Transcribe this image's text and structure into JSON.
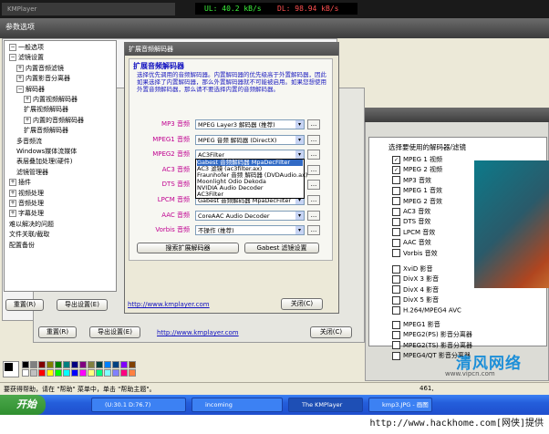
{
  "topbar": {
    "player_title": "KMPlayer",
    "upload_rate": "UL: 40.2 kB/s",
    "download_rate": "DL: 98.94 kB/s"
  },
  "window": {
    "title": "参数选项"
  },
  "tree": [
    {
      "label": "一般选项",
      "toggle": "−"
    },
    {
      "label": "滤镜设置",
      "toggle": "−"
    },
    {
      "label": "内置音频滤镜",
      "toggle": "+"
    },
    {
      "label": "内置影音分离器",
      "toggle": "+"
    },
    {
      "label": "解码器",
      "toggle": "−"
    },
    {
      "label": "内置视频解码器",
      "toggle": "+"
    },
    {
      "label": "扩展视频解码器",
      "toggle": ""
    },
    {
      "label": "内置的音频解码器",
      "toggle": "+"
    },
    {
      "label": "扩展音频解码器",
      "toggle": ""
    },
    {
      "label": "多音频流",
      "toggle": ""
    },
    {
      "label": "Windows媒体流媒体",
      "toggle": ""
    },
    {
      "label": "表层叠加处理(硬件)",
      "toggle": ""
    },
    {
      "label": "滤镜管理器",
      "toggle": ""
    },
    {
      "label": "插件",
      "toggle": "+"
    },
    {
      "label": "视频处理",
      "toggle": "+"
    },
    {
      "label": "音频处理",
      "toggle": "+"
    },
    {
      "label": "字幕处理",
      "toggle": "+"
    },
    {
      "label": "难以解决的问题",
      "toggle": ""
    },
    {
      "label": "文件关联/截取",
      "toggle": ""
    },
    {
      "label": "配置备份",
      "toggle": ""
    }
  ],
  "left_buttons": {
    "reset": "重置(R)",
    "export": "导出设置(E)"
  },
  "dialog": {
    "header": "扩展音频解码器",
    "group_title": "扩展音频解码器",
    "description": "选择优先调用的音频解码器。内置解码器的优先级高于外置解码器，因此如果选择了内置解码器，那么外置解码器就不可能被启用。如果您想使用外置音频解码器，那么请不要选择内置的音频解码器。",
    "rows": [
      {
        "label": "MP3 音频",
        "value": "MPEG Layer3 解码器 (推荐)"
      },
      {
        "label": "MPEG1 音频",
        "value": "MPEG 音频 解码器 (DirectX)"
      },
      {
        "label": "MPEG2 音频",
        "value": "AC3Filter"
      },
      {
        "label": "AC3 音频",
        "value": "AC3Filter"
      },
      {
        "label": "DTS 音频",
        "value": "AC3Filter"
      },
      {
        "label": "LPCM 音频",
        "value": "Gabest 音频解码器 MpaDecFilter"
      },
      {
        "label": "AAC 音频",
        "value": "CoreAAC Audio Decoder"
      },
      {
        "label": "Vorbis 音频",
        "value": "不操作 (推荐)"
      }
    ],
    "dropdown_options": [
      "Gabest 音频解码器 MpaDecFilter",
      "AC3 滤镜 (ac3filter.ax)",
      "Fraunhofer 音频 解码器 (DVDAudio.ax)",
      "Moonlight Odio Dekoda",
      "NVIDIA Audio Decoder",
      "AC3Filter"
    ],
    "search_button": "搜索扩展解码器",
    "gabest_button": "Gabest 滤镜设置",
    "link": "http://www.kmplayer.com",
    "close_button": "关闭(C)",
    "dots": "..."
  },
  "outer_buttons": {
    "reset": "重置(R)",
    "export": "导出设置(E)",
    "link": "http://www.kmplayer.com",
    "close": "关闭(C)"
  },
  "codec_panel": {
    "header": "选择要使用的解码器/滤镜",
    "items": [
      {
        "label": "MPEG 1 视频",
        "checked": true
      },
      {
        "label": "MPEG 2 视频",
        "checked": true
      },
      {
        "label": "MP3 音效",
        "checked": false
      },
      {
        "label": "MPEG 1 音效",
        "checked": false
      },
      {
        "label": "MPEG 2 音效",
        "checked": false
      },
      {
        "label": "AC3 音效",
        "checked": false
      },
      {
        "label": "DTS 音效",
        "checked": false
      },
      {
        "label": "LPCM 音效",
        "checked": false
      },
      {
        "label": "AAC 音效",
        "checked": false
      },
      {
        "label": "Vorbis 音效",
        "checked": false
      },
      {
        "label": "XviD 影音",
        "checked": false
      },
      {
        "label": "DivX 3 影音",
        "checked": false
      },
      {
        "label": "DivX 4 影音",
        "checked": false
      },
      {
        "label": "DivX 5 影音",
        "checked": false
      },
      {
        "label": "H.264/MPEG4 AVC",
        "checked": false
      },
      {
        "label": "MPEG1 影音",
        "checked": false
      },
      {
        "label": "MPEG2(PS) 影音分离器",
        "checked": false
      },
      {
        "label": "MPEG2(TS) 影音分离器",
        "checked": false
      },
      {
        "label": "MPEG4/QT 影音分离器",
        "checked": false
      }
    ]
  },
  "palette": [
    "#000000",
    "#808080",
    "#800000",
    "#808000",
    "#008000",
    "#008080",
    "#000080",
    "#800080",
    "#808040",
    "#004040",
    "#0080ff",
    "#004080",
    "#8000ff",
    "#804000",
    "#ffffff",
    "#c0c0c0",
    "#ff0000",
    "#ffff00",
    "#00ff00",
    "#00ffff",
    "#0000ff",
    "#ff00ff",
    "#ffff80",
    "#00ff80",
    "#80ffff",
    "#8080ff",
    "#ff0080",
    "#ff8040"
  ],
  "statusbar": {
    "text": "要获得帮助，请在 \"帮助\" 菜单中，单击 \"帮助主题\"。",
    "coords": "461,"
  },
  "taskbar": {
    "start": "开始",
    "tasks": [
      "(U:30.1 D:76.7)",
      "incoming",
      "The KMPlayer",
      "kmp3.JPG - 画图"
    ]
  },
  "watermark": {
    "brand": "清风网络",
    "url": "www.vipcn.com"
  },
  "footer": {
    "text": "http://www.hackhome.com[网侠]提供"
  }
}
